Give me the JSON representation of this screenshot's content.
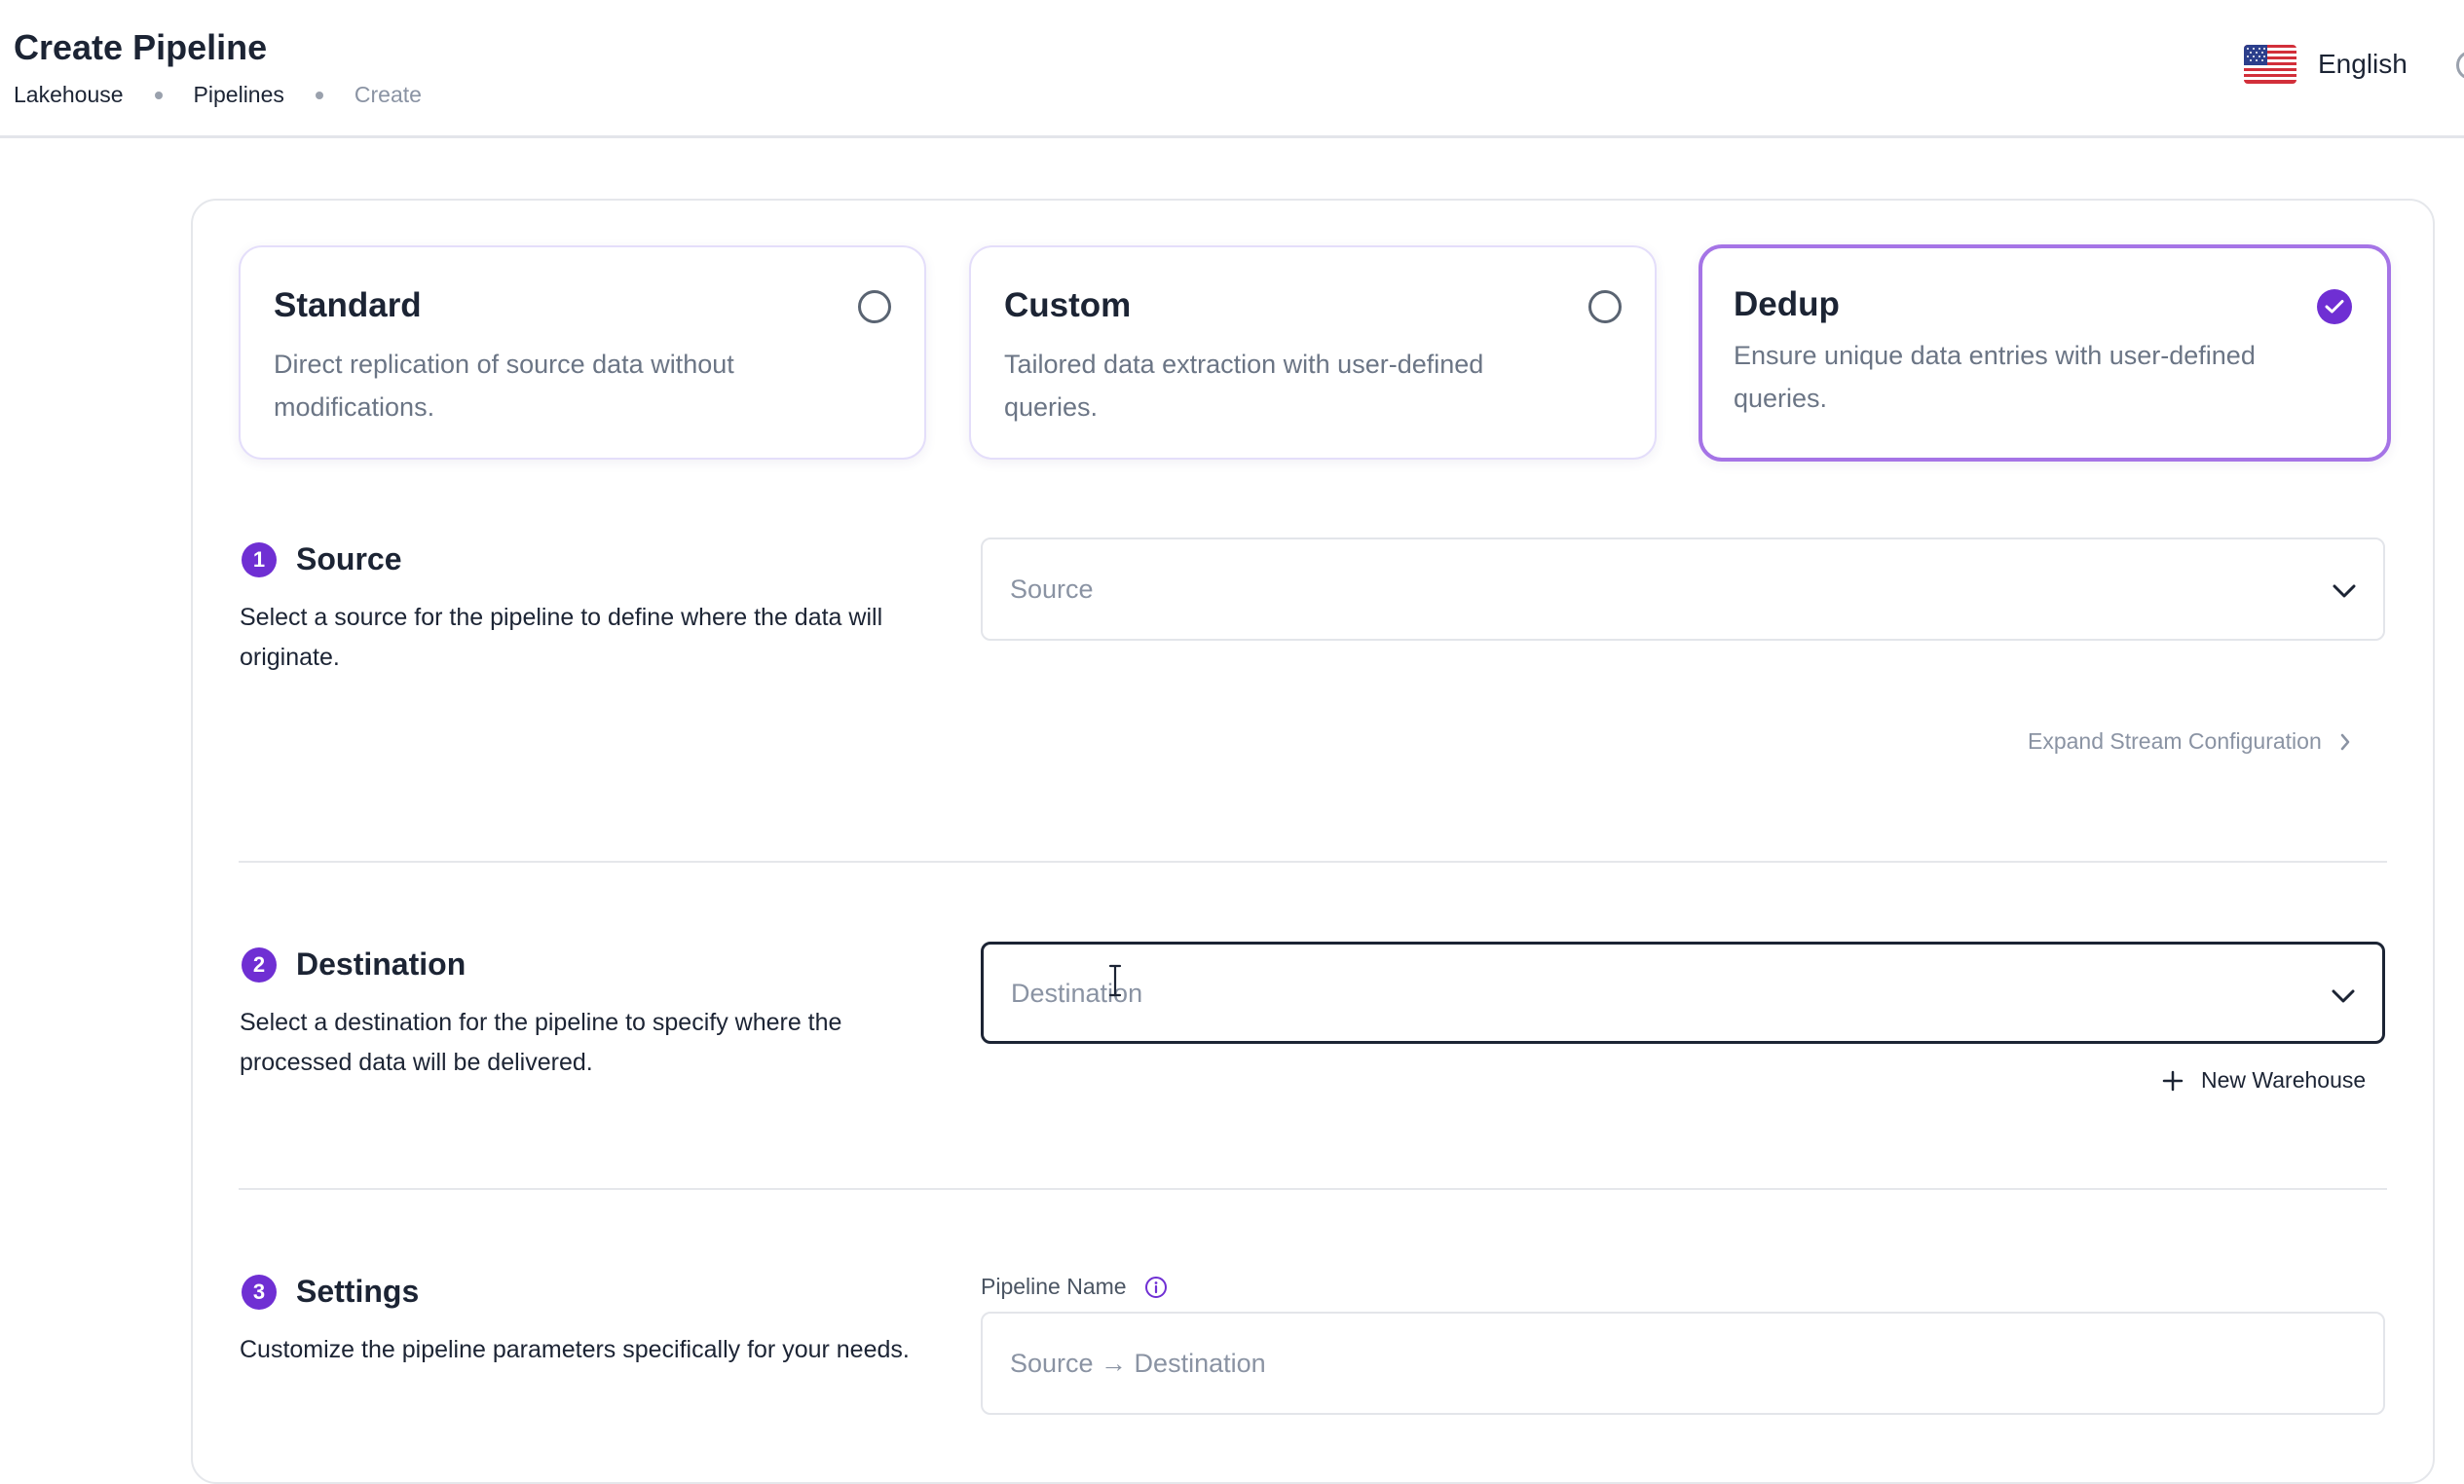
{
  "header": {
    "title": "Create Pipeline",
    "breadcrumb": [
      "Lakehouse",
      "Pipelines",
      "Create"
    ],
    "language": {
      "label": "English",
      "flag_icon": "us-flag-icon"
    }
  },
  "pipeline_types": [
    {
      "title": "Standard",
      "description": "Direct replication of source data without modifications.",
      "selected": false
    },
    {
      "title": "Custom",
      "description": "Tailored data extraction with user-defined queries.",
      "selected": false
    },
    {
      "title": "Dedup",
      "description": "Ensure unique data entries with user-defined queries.",
      "selected": true
    }
  ],
  "source": {
    "step": "1",
    "title": "Source",
    "description": "Select a source for the pipeline to define where the data will originate.",
    "placeholder": "Source",
    "expand_link": "Expand Stream Configuration"
  },
  "destination": {
    "step": "2",
    "title": "Destination",
    "description": "Select a destination for the pipeline to specify where the processed data will be delivered.",
    "placeholder": "Destination",
    "new_warehouse": "New Warehouse"
  },
  "settings": {
    "step": "3",
    "title": "Settings",
    "description": "Customize the pipeline parameters specifically for your needs.",
    "pipeline_name_label": "Pipeline Name",
    "pipeline_name_placeholder": "Source → Destination"
  },
  "colors": {
    "accent": "#6f2fd3",
    "selected_border": "#a574e6",
    "text": "#1c2434",
    "muted": "#8a93a3"
  }
}
